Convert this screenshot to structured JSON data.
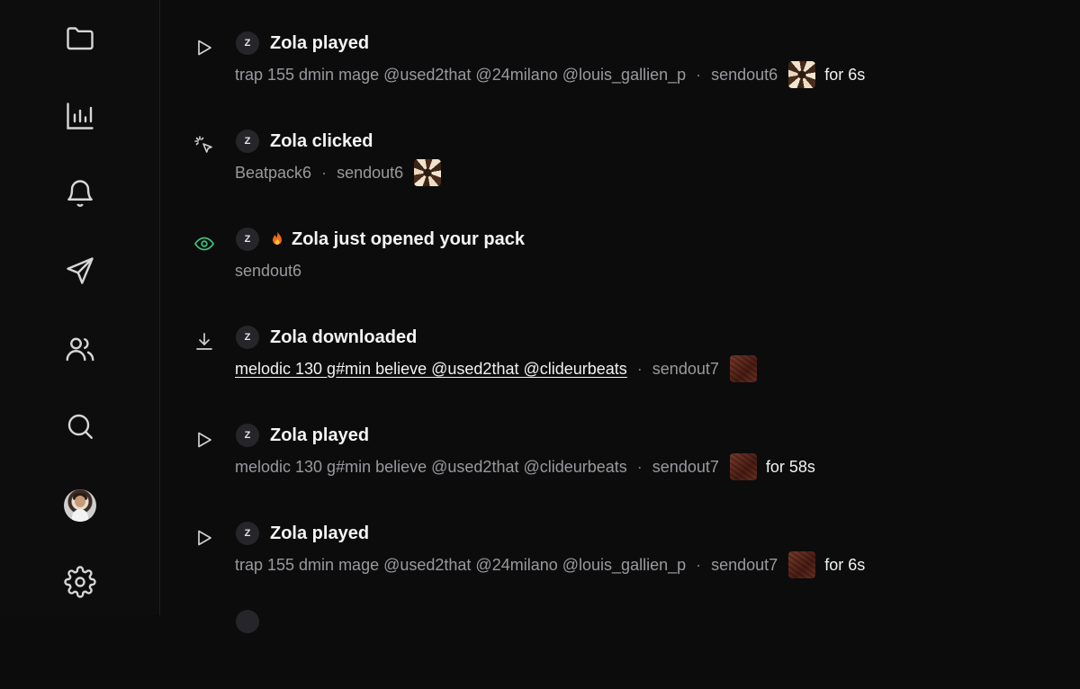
{
  "sidebar": {
    "icons": [
      "folder-icon",
      "chart-icon",
      "bell-icon",
      "send-icon",
      "users-icon",
      "search-icon",
      "avatar",
      "gear-icon"
    ]
  },
  "feed": [
    {
      "icon": "play-icon",
      "badge": "Z",
      "title": "Zola played",
      "track": "trap 155 dmin mage @used2that @24milano @louis_gallien_p",
      "sendout": "sendout6",
      "thumb": "swirl",
      "duration": "for 6s"
    },
    {
      "icon": "click-icon",
      "badge": "Z",
      "title": "Zola clicked",
      "track": "Beatpack6",
      "sendout": "sendout6",
      "thumb": "swirl"
    },
    {
      "icon": "eye-icon",
      "badge": "Z",
      "title": "Zola just opened your pack",
      "sendout": "sendout6",
      "accent": "#3fbf7f"
    },
    {
      "icon": "download-icon",
      "badge": "Z",
      "title": "Zola downloaded",
      "track": "melodic 130 g#min believe @used2that @clideurbeats",
      "sendout": "sendout7",
      "thumb": "brown"
    },
    {
      "icon": "play-icon",
      "badge": "Z",
      "title": "Zola played",
      "track": "melodic 130 g#min believe @used2that @clideurbeats",
      "sendout": "sendout7",
      "thumb": "brown",
      "duration": "for 58s"
    },
    {
      "icon": "play-icon",
      "badge": "Z",
      "title": "Zola played",
      "track": "trap 155 dmin mage @used2that @24milano @louis_gallien_p",
      "sendout": "sendout7",
      "thumb": "brown",
      "duration": "for 6s"
    }
  ]
}
